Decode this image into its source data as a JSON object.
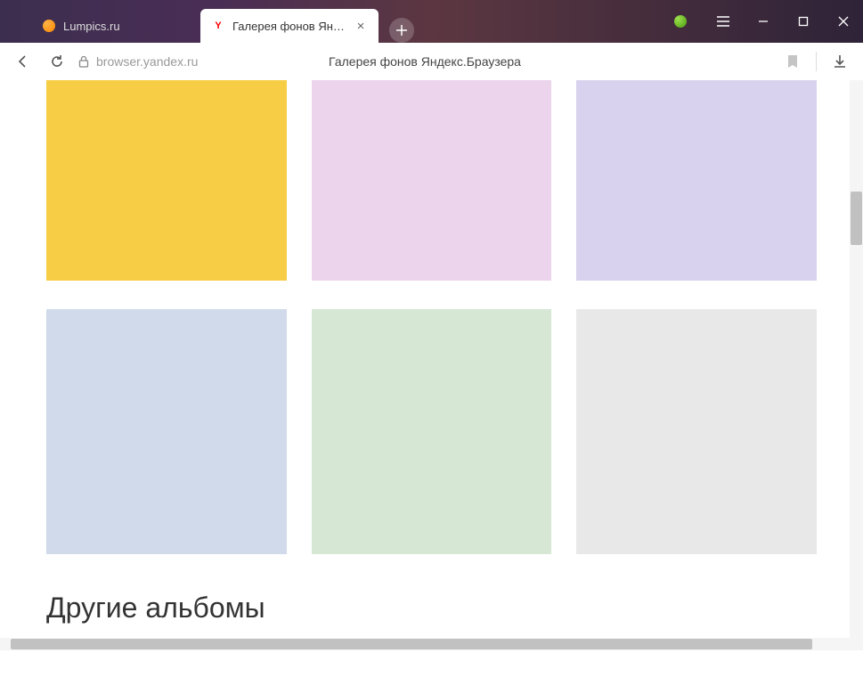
{
  "tabs": [
    {
      "label": "Lumpics.ru",
      "favicon": "orange"
    },
    {
      "label": "Галерея фонов Яндекс",
      "favicon": "y",
      "active": true
    }
  ],
  "window": {
    "new_tab": "+",
    "minimize": "—",
    "maximize": "☐",
    "close": "✕"
  },
  "toolbar": {
    "url": "browser.yandex.ru",
    "page_title": "Галерея фонов Яндекс.Браузера"
  },
  "gallery": {
    "row1": [
      {
        "color": "#f7cd46"
      },
      {
        "color": "#ecd4ed"
      },
      {
        "color": "#d8d2ee"
      }
    ],
    "row2": [
      {
        "color": "#d0daea"
      },
      {
        "color": "#d6e7d4"
      },
      {
        "color": "#e8e8e8"
      }
    ],
    "section_title": "Другие альбомы"
  }
}
